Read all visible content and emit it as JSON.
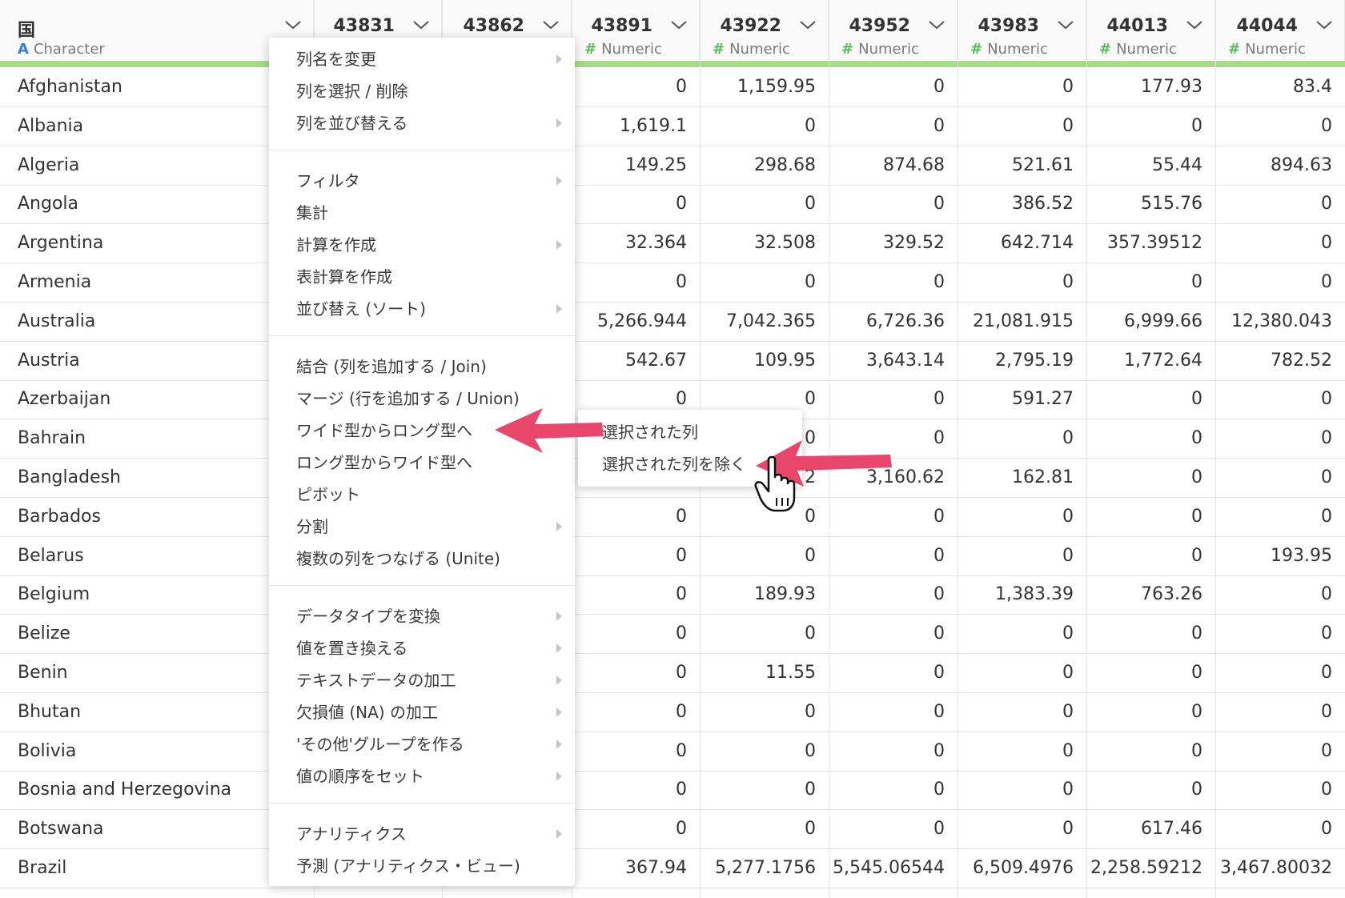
{
  "columns": [
    {
      "title": "国",
      "type": "Character",
      "type_mark": "A"
    },
    {
      "title": "43831",
      "type": "",
      "type_mark": ""
    },
    {
      "title": "43862",
      "type": "",
      "type_mark": ""
    },
    {
      "title": "43891",
      "type": "Numeric",
      "type_mark": "#"
    },
    {
      "title": "43922",
      "type": "Numeric",
      "type_mark": "#"
    },
    {
      "title": "43952",
      "type": "Numeric",
      "type_mark": "#"
    },
    {
      "title": "43983",
      "type": "Numeric",
      "type_mark": "#"
    },
    {
      "title": "44013",
      "type": "Numeric",
      "type_mark": "#"
    },
    {
      "title": "44044",
      "type": "Numeric",
      "type_mark": "#"
    }
  ],
  "rows": [
    {
      "country": "Afghanistan",
      "values": [
        "0",
        "1,159.95",
        "0",
        "0",
        "177.93",
        "83.4"
      ]
    },
    {
      "country": "Albania",
      "values": [
        "1,619.1",
        "0",
        "0",
        "0",
        "0",
        "0"
      ]
    },
    {
      "country": "Algeria",
      "values": [
        "149.25",
        "298.68",
        "874.68",
        "521.61",
        "55.44",
        "894.63"
      ]
    },
    {
      "country": "Angola",
      "values": [
        "0",
        "0",
        "0",
        "386.52",
        "515.76",
        "0"
      ]
    },
    {
      "country": "Argentina",
      "values": [
        "32.364",
        "32.508",
        "329.52",
        "642.714",
        "357.39512",
        "0"
      ]
    },
    {
      "country": "Armenia",
      "values": [
        "0",
        "0",
        "0",
        "0",
        "0",
        "0"
      ]
    },
    {
      "country": "Australia",
      "values": [
        "5,266.944",
        "7,042.365",
        "6,726.36",
        "21,081.915",
        "6,999.66",
        "12,380.043"
      ]
    },
    {
      "country": "Austria",
      "values": [
        "542.67",
        "109.95",
        "3,643.14",
        "2,795.19",
        "1,772.64",
        "782.52"
      ]
    },
    {
      "country": "Azerbaijan",
      "values": [
        "0",
        "0",
        "0",
        "591.27",
        "0",
        "0"
      ]
    },
    {
      "country": "Bahrain",
      "values": [
        "",
        "0",
        "0",
        "0",
        "0",
        "0"
      ]
    },
    {
      "country": "Bangladesh",
      "values": [
        "",
        "2",
        "3,160.62",
        "162.81",
        "0",
        "0"
      ]
    },
    {
      "country": "Barbados",
      "values": [
        "0",
        "0",
        "0",
        "0",
        "0",
        "0"
      ]
    },
    {
      "country": "Belarus",
      "values": [
        "0",
        "0",
        "0",
        "0",
        "0",
        "193.95"
      ]
    },
    {
      "country": "Belgium",
      "values": [
        "0",
        "189.93",
        "0",
        "1,383.39",
        "763.26",
        "0"
      ]
    },
    {
      "country": "Belize",
      "values": [
        "0",
        "0",
        "0",
        "0",
        "0",
        "0"
      ]
    },
    {
      "country": "Benin",
      "values": [
        "0",
        "11.55",
        "0",
        "0",
        "0",
        "0"
      ]
    },
    {
      "country": "Bhutan",
      "values": [
        "0",
        "0",
        "0",
        "0",
        "0",
        "0"
      ]
    },
    {
      "country": "Bolivia",
      "values": [
        "0",
        "0",
        "0",
        "0",
        "0",
        "0"
      ]
    },
    {
      "country": "Bosnia and Herzegovina",
      "values": [
        "0",
        "0",
        "0",
        "0",
        "0",
        "0"
      ]
    },
    {
      "country": "Botswana",
      "values": [
        "0",
        "0",
        "0",
        "0",
        "617.46",
        "0"
      ]
    },
    {
      "country": "Brazil",
      "values": [
        "367.94",
        "5,277.1756",
        "5,545.06544",
        "6,509.4976",
        "2,258.59212",
        "3,467.80032"
      ]
    }
  ],
  "menu": {
    "groups": [
      [
        {
          "label": "列名を変更",
          "submenu": true
        },
        {
          "label": "列を選択 / 削除",
          "submenu": false
        },
        {
          "label": "列を並び替える",
          "submenu": true
        }
      ],
      [
        {
          "label": "フィルタ",
          "submenu": true
        },
        {
          "label": "集計",
          "submenu": false
        },
        {
          "label": "計算を作成",
          "submenu": true
        },
        {
          "label": "表計算を作成",
          "submenu": false
        },
        {
          "label": "並び替え (ソート)",
          "submenu": true
        }
      ],
      [
        {
          "label": "結合 (列を追加する / Join)",
          "submenu": false
        },
        {
          "label": "マージ (行を追加する / Union)",
          "submenu": false
        },
        {
          "label": "ワイド型からロング型へ",
          "submenu": false
        },
        {
          "label": "ロング型からワイド型へ",
          "submenu": false
        },
        {
          "label": "ピボット",
          "submenu": false
        },
        {
          "label": "分割",
          "submenu": true
        },
        {
          "label": "複数の列をつなげる (Unite)",
          "submenu": false
        }
      ],
      [
        {
          "label": "データタイプを変換",
          "submenu": true
        },
        {
          "label": "値を置き換える",
          "submenu": true
        },
        {
          "label": "テキストデータの加工",
          "submenu": true
        },
        {
          "label": "欠損値 (NA) の加工",
          "submenu": true
        },
        {
          "label": "'その他'グループを作る",
          "submenu": true
        },
        {
          "label": "値の順序をセット",
          "submenu": true
        }
      ],
      [
        {
          "label": "アナリティクス",
          "submenu": true
        },
        {
          "label": "予測 (アナリティクス・ビュー)",
          "submenu": false
        }
      ]
    ]
  },
  "submenu": {
    "items": [
      "選択された列",
      "選択された列を除く"
    ]
  },
  "colors": {
    "header_bar": "#a9d98a",
    "arrow": "#e8466a",
    "character_type": "#3a7bd5",
    "numeric_type": "#5cb85c"
  }
}
